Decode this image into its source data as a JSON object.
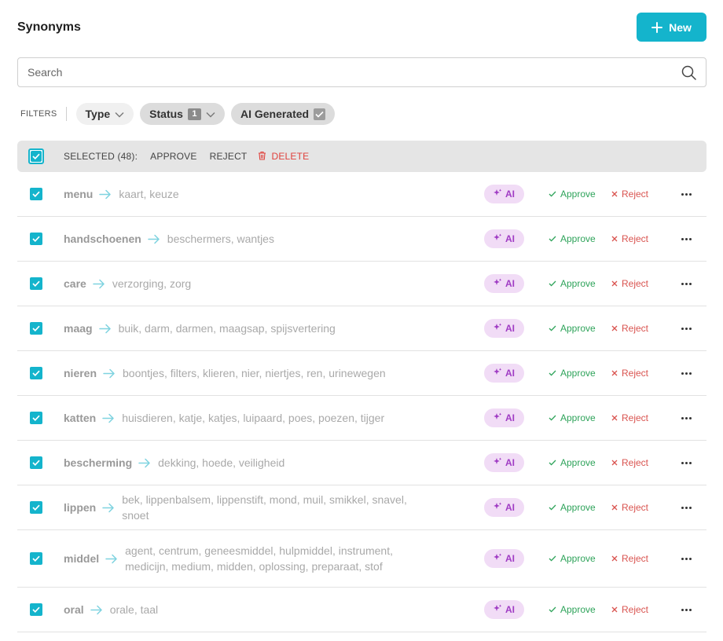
{
  "header": {
    "title": "Synonyms",
    "new_label": "New"
  },
  "search": {
    "placeholder": "Search"
  },
  "filters": {
    "label": "FILTERS",
    "type_label": "Type",
    "status_label": "Status",
    "status_count": "1",
    "ai_label": "AI Generated"
  },
  "bulk": {
    "selected_text": "SELECTED (48):",
    "approve_label": "APPROVE",
    "reject_label": "REJECT",
    "delete_label": "DELETE"
  },
  "row_labels": {
    "ai": "AI",
    "approve": "Approve",
    "reject": "Reject"
  },
  "colors": {
    "accent": "#14b4cc",
    "approve": "#2ea35a",
    "reject": "#d9534f",
    "ai_badge_bg": "#f1dcf6",
    "ai_badge_fg": "#a03cc4"
  },
  "rows": [
    {
      "term": "menu",
      "synonyms": "kaart, keuze"
    },
    {
      "term": "handschoenen",
      "synonyms": "beschermers, wantjes"
    },
    {
      "term": "care",
      "synonyms": "verzorging, zorg"
    },
    {
      "term": "maag",
      "synonyms": "buik, darm, darmen, maagsap, spijsvertering"
    },
    {
      "term": "nieren",
      "synonyms": "boontjes, filters, klieren, nier, niertjes, ren, urinewegen"
    },
    {
      "term": "katten",
      "synonyms": "huisdieren, katje, katjes, luipaard, poes, poezen, tijger"
    },
    {
      "term": "bescherming",
      "synonyms": "dekking, hoede, veiligheid"
    },
    {
      "term": "lippen",
      "synonyms": "bek, lippenbalsem, lippenstift, mond, muil, smikkel, snavel, snoet"
    },
    {
      "term": "middel",
      "synonyms": "agent, centrum, geneesmiddel, hulpmiddel, instrument, medicijn, medium, midden, oplossing, preparaat, stof"
    },
    {
      "term": "oral",
      "synonyms": "orale, taal"
    }
  ]
}
